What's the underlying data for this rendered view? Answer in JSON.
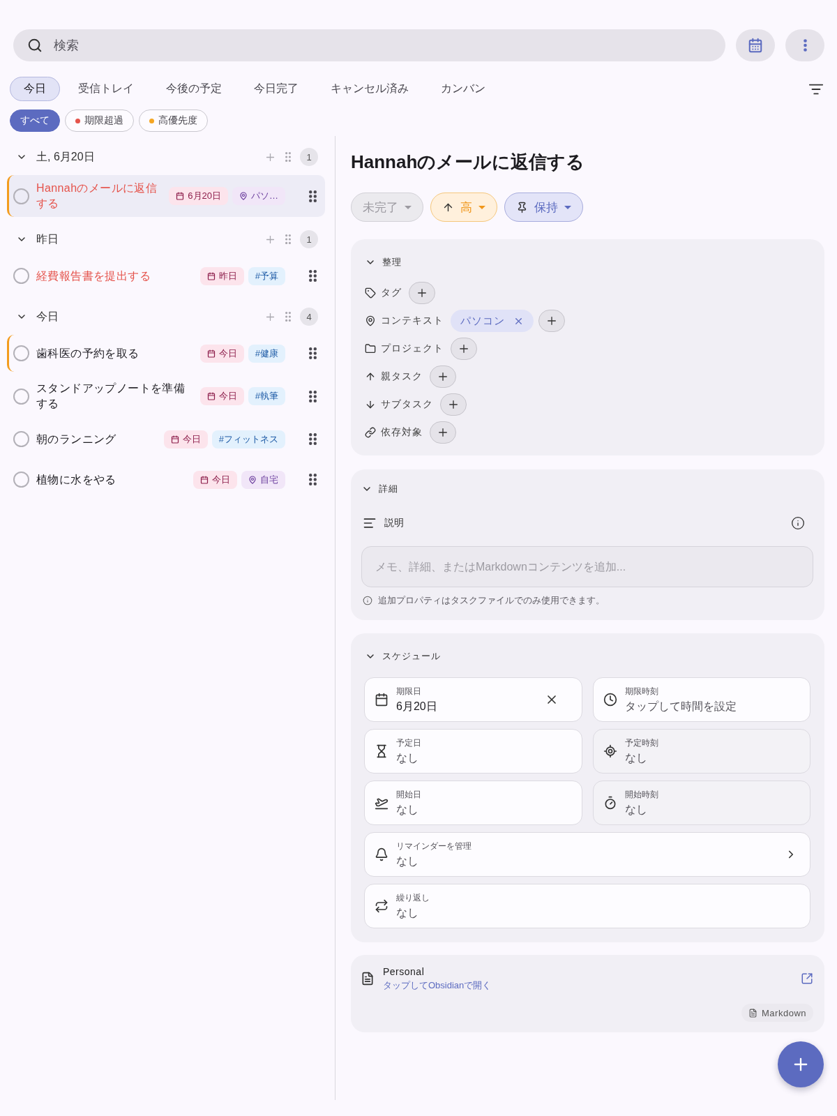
{
  "search": {
    "placeholder": "検索"
  },
  "view_tabs": [
    {
      "label": "今日",
      "selected": true
    },
    {
      "label": "受信トレイ",
      "selected": false
    },
    {
      "label": "今後の予定",
      "selected": false
    },
    {
      "label": "今日完了",
      "selected": false
    },
    {
      "label": "キャンセル済み",
      "selected": false
    },
    {
      "label": "カンバン",
      "selected": false
    }
  ],
  "filter_chips": [
    {
      "label": "すべて",
      "selected": true
    },
    {
      "label": "期限超過",
      "selected": false,
      "color": "#e5534b"
    },
    {
      "label": "高優先度",
      "selected": false,
      "color": "#f5a623"
    }
  ],
  "task_groups": [
    {
      "title": "土, 6月20日",
      "count": "1",
      "expanded": true,
      "tasks": [
        {
          "title": "Hannahのメールに返信する",
          "checked": false,
          "overdue": true,
          "high_priority": true,
          "selected": true,
          "chips": [
            {
              "kind": "date",
              "label": "6月20日"
            },
            {
              "kind": "context",
              "label": "パソ…"
            }
          ]
        }
      ]
    },
    {
      "title": "昨日",
      "count": "1",
      "expanded": true,
      "tasks": [
        {
          "title": "経費報告書を提出する",
          "checked": false,
          "overdue": true,
          "high_priority": false,
          "selected": false,
          "chips": [
            {
              "kind": "date",
              "label": "昨日"
            },
            {
              "kind": "tag",
              "label": "#予算"
            }
          ]
        }
      ]
    },
    {
      "title": "今日",
      "count": "4",
      "expanded": true,
      "tasks": [
        {
          "title": "歯科医の予約を取る",
          "checked": false,
          "overdue": false,
          "high_priority": true,
          "selected": false,
          "chips": [
            {
              "kind": "date",
              "label": "今日"
            },
            {
              "kind": "tag",
              "label": "#健康"
            }
          ]
        },
        {
          "title": "スタンドアップノートを準備する",
          "checked": false,
          "overdue": false,
          "high_priority": false,
          "selected": false,
          "chips": [
            {
              "kind": "date",
              "label": "今日"
            },
            {
              "kind": "tag",
              "label": "#執筆"
            }
          ]
        },
        {
          "title": "朝のランニング",
          "checked": false,
          "overdue": false,
          "high_priority": false,
          "selected": false,
          "chips": [
            {
              "kind": "date",
              "label": "今日"
            },
            {
              "kind": "tag",
              "label": "#フィットネス"
            }
          ]
        },
        {
          "title": "植物に水をやる",
          "checked": false,
          "overdue": false,
          "high_priority": false,
          "selected": false,
          "chips": [
            {
              "kind": "date",
              "label": "今日"
            },
            {
              "kind": "context",
              "label": "自宅"
            }
          ]
        }
      ]
    }
  ],
  "task_detail": {
    "title": "Hannahのメールに返信する",
    "status_chips": [
      {
        "kind": "status",
        "label": "未完了"
      },
      {
        "kind": "priority",
        "label": "高"
      },
      {
        "kind": "pin",
        "label": "保持"
      }
    ],
    "organize": {
      "title": "整理",
      "expanded": true,
      "rows": [
        {
          "kind": "tag",
          "label": "タグ"
        },
        {
          "kind": "context",
          "label": "コンテキスト",
          "values": [
            {
              "label": "パソコン"
            }
          ]
        },
        {
          "kind": "project",
          "label": "プロジェクト"
        },
        {
          "kind": "parent",
          "label": "親タスク"
        },
        {
          "kind": "subtask",
          "label": "サブタスク"
        },
        {
          "kind": "dependency",
          "label": "依存対象"
        }
      ]
    },
    "details": {
      "title": "詳細",
      "expanded": true,
      "description_label": "説明",
      "description": {
        "placeholder": "メモ、詳細、またはMarkdownコンテンツを追加..."
      },
      "note": "追加プロパティはタスクファイルでのみ使用できます。"
    },
    "schedule": {
      "title": "スケジュール",
      "expanded": true,
      "fields": [
        {
          "kind": "due_date",
          "label": "期限日",
          "value": "6月20日",
          "filled": true,
          "clearable": true,
          "disabled": false,
          "wide": false
        },
        {
          "kind": "due_time",
          "label": "期限時刻",
          "value": "タップして時間を設定",
          "filled": false,
          "clearable": false,
          "disabled": false,
          "wide": false
        },
        {
          "kind": "scheduled_date",
          "label": "予定日",
          "value": "なし",
          "filled": false,
          "clearable": false,
          "disabled": false,
          "wide": false
        },
        {
          "kind": "scheduled_time",
          "label": "予定時刻",
          "value": "なし",
          "filled": false,
          "clearable": false,
          "disabled": true,
          "wide": false
        },
        {
          "kind": "start_date",
          "label": "開始日",
          "value": "なし",
          "filled": false,
          "clearable": false,
          "disabled": false,
          "wide": false
        },
        {
          "kind": "start_time",
          "label": "開始時刻",
          "value": "なし",
          "filled": false,
          "clearable": false,
          "disabled": true,
          "wide": false
        },
        {
          "kind": "reminders",
          "label": "リマインダーを管理",
          "value": "なし",
          "filled": false,
          "clearable": false,
          "disabled": false,
          "wide": true
        },
        {
          "kind": "recurrence",
          "label": "繰り返し",
          "value": "なし",
          "filled": false,
          "clearable": false,
          "disabled": false,
          "wide": true
        }
      ]
    },
    "file": {
      "vault": "Personal",
      "link": "タップしてObsidianで開く",
      "format": "Markdown"
    }
  }
}
